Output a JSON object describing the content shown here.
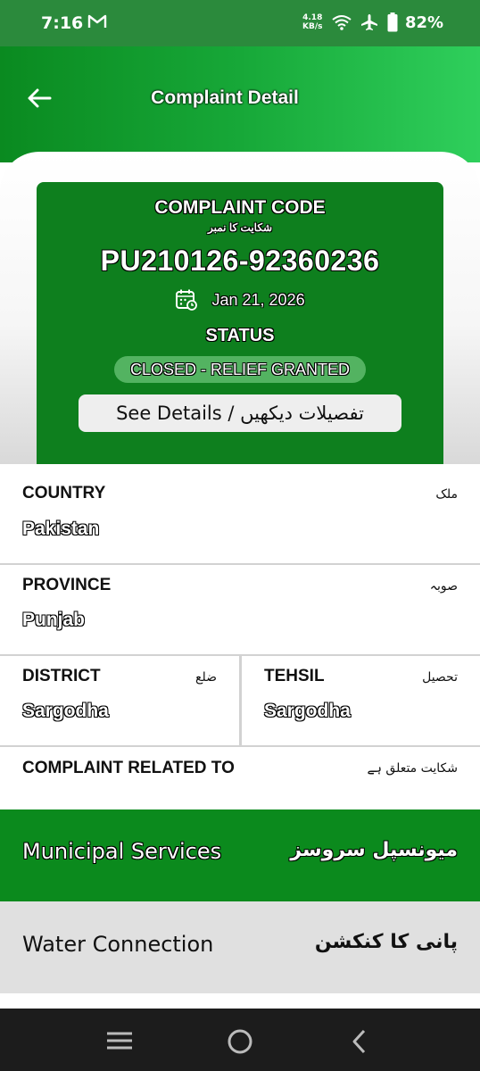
{
  "status_bar": {
    "time": "7:16",
    "speed_top": "4.18",
    "speed_bottom": "KB/s",
    "battery": "82%"
  },
  "header": {
    "title": "Complaint Detail"
  },
  "complaint_card": {
    "code_heading": "COMPLAINT CODE",
    "code_heading_ur": "شکایت کا نمبر",
    "code": "PU210126-92360236",
    "date": "Jan 21, 2026",
    "status_heading": "STATUS",
    "status": "CLOSED - RELIEF GRANTED",
    "see_details": "See Details / تفصیلات دیکھیں"
  },
  "fields": {
    "country": {
      "label": "COUNTRY",
      "label_ur": "ملک",
      "value": "Pakistan"
    },
    "province": {
      "label": "PROVINCE",
      "label_ur": "صوبہ",
      "value": "Punjab"
    },
    "district": {
      "label": "DISTRICT",
      "label_ur": "ضلع",
      "value": "Sargodha"
    },
    "tehsil": {
      "label": "TEHSIL",
      "label_ur": "تحصیل",
      "value": "Sargodha"
    },
    "related": {
      "label": "COMPLAINT RELATED TO",
      "label_ur": "شکایت متعلق ہے"
    }
  },
  "services": {
    "municipal": {
      "label": "Municipal Services",
      "label_ur": "میونسپل سروسز"
    },
    "water": {
      "label": "Water Connection",
      "label_ur": "پانی کا کنکشن"
    }
  },
  "colors": {
    "status_bar": "#2b8a3c",
    "card_green": "#0e7f1e",
    "badge_green": "#53b361",
    "municipal_green": "#0b8a1d",
    "water_gray": "#e0e0e0"
  }
}
